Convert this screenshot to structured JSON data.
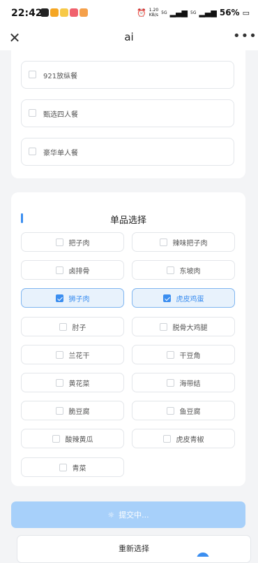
{
  "status_bar": {
    "time": "22:42",
    "speed": "1.20\nKB/s",
    "net1": "5G",
    "net2": "5G",
    "battery": "56%"
  },
  "header": {
    "title": "ai",
    "close_icon": "close-icon",
    "more_icon": "more-icon"
  },
  "meal_options": [
    {
      "label": "921放纵餐",
      "checked": false
    },
    {
      "label": "甄选四人餐",
      "checked": false
    },
    {
      "label": "豪华单人餐",
      "checked": false
    }
  ],
  "single_section": {
    "title": "单品选择",
    "items": [
      {
        "label": "把子肉",
        "checked": false
      },
      {
        "label": "辣味把子肉",
        "checked": false
      },
      {
        "label": "卤排骨",
        "checked": false
      },
      {
        "label": "东坡肉",
        "checked": false
      },
      {
        "label": "狮子肉",
        "checked": true
      },
      {
        "label": "虎皮鸡蛋",
        "checked": true
      },
      {
        "label": "肘子",
        "checked": false
      },
      {
        "label": "脱骨大鸡腿",
        "checked": false
      },
      {
        "label": "兰花干",
        "checked": false
      },
      {
        "label": "干豆角",
        "checked": false
      },
      {
        "label": "黄花菜",
        "checked": false
      },
      {
        "label": "海带结",
        "checked": false
      },
      {
        "label": "脆豆腐",
        "checked": false
      },
      {
        "label": "鱼豆腐",
        "checked": false
      },
      {
        "label": "酸辣黄瓜",
        "checked": false
      },
      {
        "label": "虎皮青椒",
        "checked": false
      },
      {
        "label": "青菜",
        "checked": false
      }
    ]
  },
  "actions": {
    "submit_label": "提交中...",
    "reset_label": "重新选择"
  },
  "colors": {
    "accent": "#3b8ef0",
    "submit_bg": "#a7d0fa",
    "checked_bg": "#e8f2fc"
  }
}
